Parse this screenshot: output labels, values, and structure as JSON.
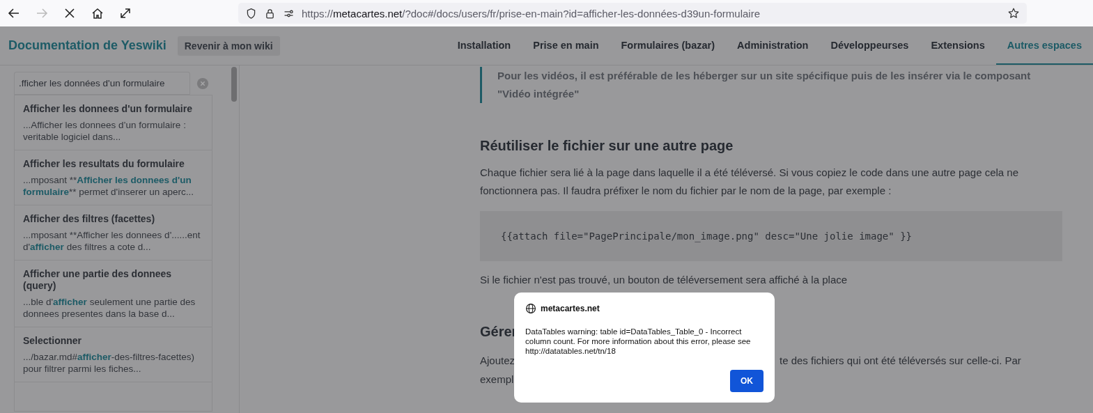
{
  "browser": {
    "forward": {
      "disabled": true
    },
    "url": {
      "prefix": "https://",
      "domain": "metacartes.net",
      "rest": "/?doc#/docs/users/fr/prise-en-main?id=afficher-les-données-d39un-formulaire"
    }
  },
  "header": {
    "title": "Documentation de Yeswiki",
    "back_button": "Revenir à mon wiki",
    "nav": [
      {
        "label": "Installation",
        "selected": false
      },
      {
        "label": "Prise en main",
        "selected": false
      },
      {
        "label": "Formulaires (bazar)",
        "selected": false
      },
      {
        "label": "Administration",
        "selected": false
      },
      {
        "label": "Développeurses",
        "selected": false
      },
      {
        "label": "Extensions",
        "selected": false
      },
      {
        "label": "Autres espaces",
        "selected": true
      }
    ]
  },
  "sidebar": {
    "search": {
      "value": ".fficher les données d'un formulaire"
    },
    "results": [
      {
        "title": "Afficher les donnees d'un formulaire",
        "snippet": [
          {
            "text": "...Afficher les donnees d’un formulaire : veritable logiciel dans...",
            "highlight": false
          }
        ]
      },
      {
        "title": "Afficher les resultats du formulaire",
        "snippet": [
          {
            "text": "...mposant **",
            "highlight": false
          },
          {
            "text": "Afficher les donnees d'un formulaire",
            "highlight": true
          },
          {
            "text": "** permet d'inserer un aperc...",
            "highlight": false
          }
        ]
      },
      {
        "title": "Afficher des filtres (facettes)",
        "snippet": [
          {
            "text": "...mposant **Afficher les donnees d'......ent d'",
            "highlight": false
          },
          {
            "text": "afficher",
            "highlight": true
          },
          {
            "text": " des filtres a cote d...",
            "highlight": false
          }
        ]
      },
      {
        "title": "Afficher une partie des donnees (query)",
        "snippet": [
          {
            "text": "...ble d'",
            "highlight": false
          },
          {
            "text": "afficher",
            "highlight": true
          },
          {
            "text": " seulement une partie des donnees presentes dans la base d...",
            "highlight": false
          }
        ]
      },
      {
        "title": "Selectionner",
        "snippet": [
          {
            "text": ".../bazar.md#",
            "highlight": false
          },
          {
            "text": "afficher",
            "highlight": true
          },
          {
            "text": "-des-filtres-facettes) pour filtrer parmi les fiches...",
            "highlight": false
          }
        ]
      }
    ]
  },
  "content": [
    {
      "kind": "quote",
      "text": "Pour les vidéos, il est préférable de les héberger sur un site spécifique puis de les insérer via le composant \"Vidéo intégrée\""
    },
    {
      "kind": "heading",
      "text": "Réutiliser le fichier sur une autre page"
    },
    {
      "kind": "paragraph",
      "text": "Chaque fichier sera lié à la page dans laquelle il a été téléversé. Si vous copiez le code dans une autre page cela ne fonctionnera pas. Il faudra préfixer le nom du fichier par le nom de la page, par exemple :"
    },
    {
      "kind": "code",
      "text": "{{attach file=\"PagePrincipale/mon_image.png\" desc=\"Une jolie image\" }}"
    },
    {
      "kind": "paragraph",
      "text": "Si le fichier n'est pas trouvé, un bouton de téléversement sera affiché à la place"
    },
    {
      "kind": "heading",
      "text": "Gérer"
    },
    {
      "kind": "covered",
      "lines": [
        [
          "Ajoutez",
          "te des fichiers qui ont été téléversés sur celle-ci. Par"
        ],
        [
          "exempl"
        ]
      ]
    }
  ],
  "dialog": {
    "site": "metacartes.net",
    "message": "DataTables warning: table id=DataTables_Table_0 - Incorrect column count. For more information about this error, please see http://datatables.net/tn/18",
    "button": "OK"
  }
}
